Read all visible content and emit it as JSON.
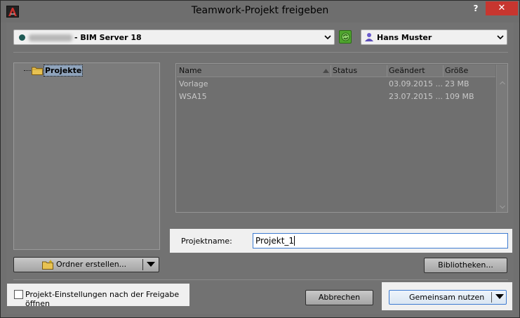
{
  "window": {
    "title": "Teamwork-Projekt freigeben",
    "help_label": "?",
    "close_label": "✕"
  },
  "server": {
    "name": "- BIM Server 18",
    "status_color": "#1f5a55"
  },
  "refresh_color": "#4fa42e",
  "user": {
    "name": "Hans Muster"
  },
  "tree": {
    "root_label": "Projekte"
  },
  "list": {
    "columns": {
      "name": "Name",
      "status": "Status",
      "changed": "Geändert",
      "size": "Größe"
    },
    "rows": [
      {
        "name": "Vorlage",
        "status": "",
        "changed": "03.09.2015 ...",
        "size": "23 MB"
      },
      {
        "name": "WSA15",
        "status": "",
        "changed": "23.07.2015 ...",
        "size": "109 MB"
      }
    ]
  },
  "project_name": {
    "label": "Projektname:",
    "value": "Projekt_1"
  },
  "buttons": {
    "new_folder": "Ordner erstellen...",
    "libraries": "Bibliotheken...",
    "cancel": "Abbrechen",
    "share": "Gemeinsam nutzen"
  },
  "option": {
    "open_settings_label": "Projekt-Einstellungen nach der Freigabe öffnen",
    "checked": false
  },
  "accent_color": "#3d7bd1"
}
